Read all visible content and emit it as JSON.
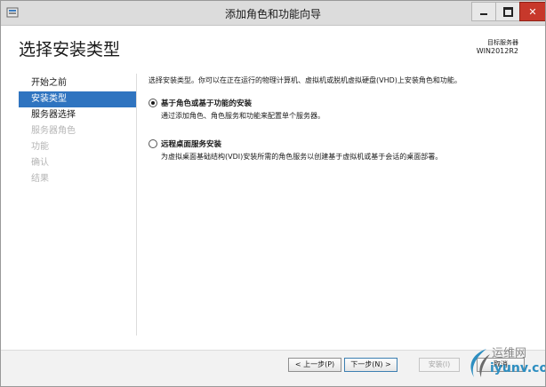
{
  "window": {
    "title": "添加角色和功能向导",
    "controls": {
      "minimize": "minimize",
      "maximize": "maximize",
      "close": "✕"
    }
  },
  "header": {
    "page_title": "选择安装类型",
    "target_label": "目标服务器",
    "target_name": "WIN2012R2"
  },
  "nav": {
    "items": [
      {
        "label": "开始之前",
        "state": "normal"
      },
      {
        "label": "安装类型",
        "state": "active"
      },
      {
        "label": "服务器选择",
        "state": "normal"
      },
      {
        "label": "服务器角色",
        "state": "disabled"
      },
      {
        "label": "功能",
        "state": "disabled"
      },
      {
        "label": "确认",
        "state": "disabled"
      },
      {
        "label": "结果",
        "state": "disabled"
      }
    ]
  },
  "content": {
    "intro": "选择安装类型。你可以在正在运行的物理计算机、虚拟机或脱机虚拟硬盘(VHD)上安装角色和功能。",
    "options": [
      {
        "title": "基于角色或基于功能的安装",
        "description": "通过添加角色、角色服务和功能来配置单个服务器。",
        "selected": true
      },
      {
        "title": "远程桌面服务安装",
        "description": "为虚拟桌面基础结构(VDI)安装所需的角色服务以创建基于虚拟机或基于会话的桌面部署。",
        "selected": false
      }
    ]
  },
  "footer": {
    "prev": "< 上一步(P)",
    "next": "下一步(N) >",
    "install": "安装(I)",
    "cancel": "取消"
  },
  "watermark": {
    "top": "运维网",
    "bottom": "iyunv.com"
  },
  "colors": {
    "accent": "#2f74c0",
    "close": "#c7382b",
    "disabled": "#b5b5b5"
  }
}
